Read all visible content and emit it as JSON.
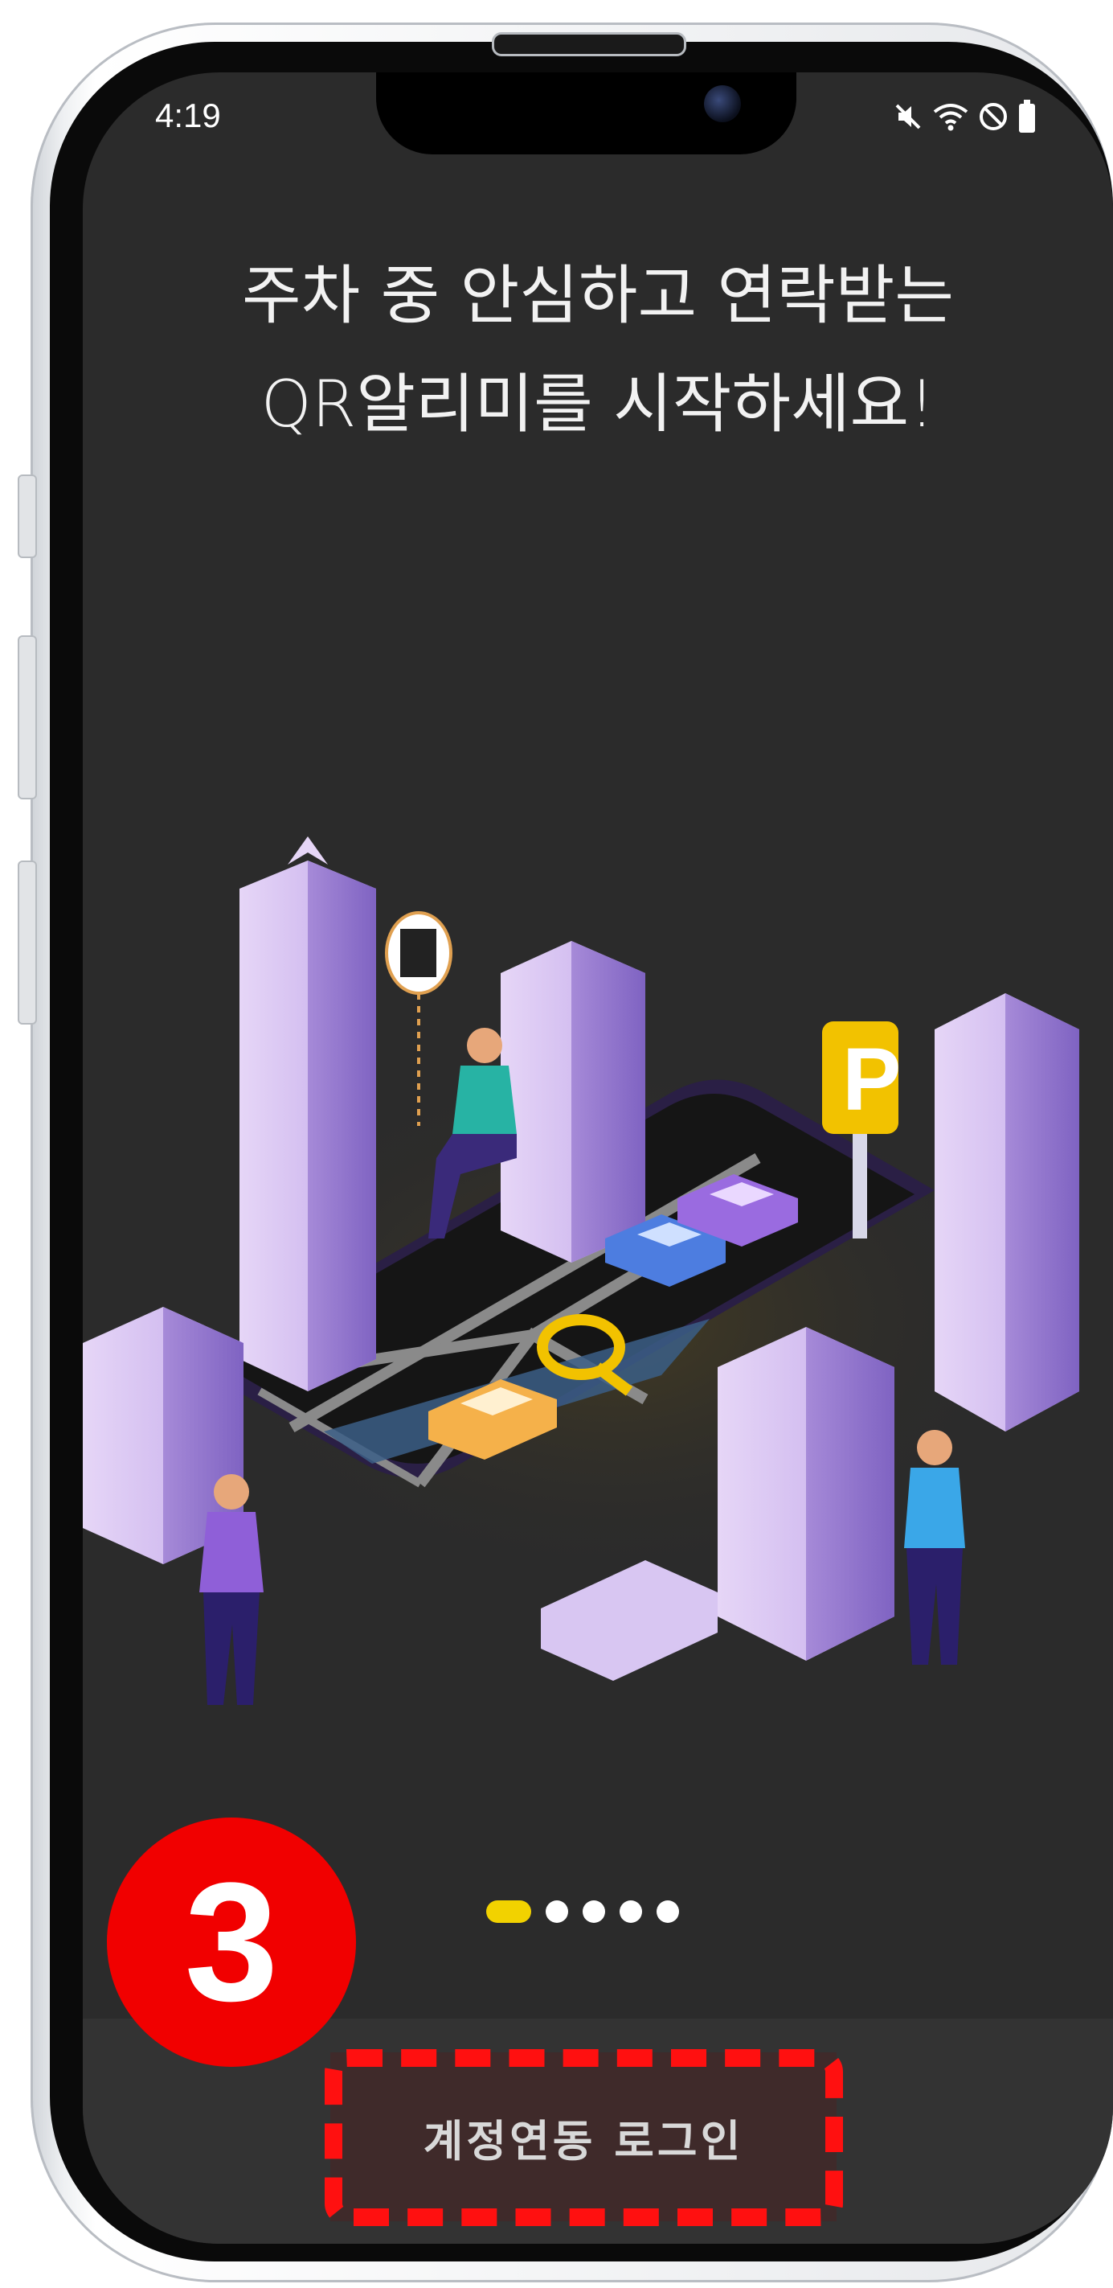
{
  "status_bar": {
    "time": "4:19",
    "icons": [
      "mute-icon",
      "wifi-icon",
      "do-not-disturb-icon",
      "battery-icon"
    ]
  },
  "onboarding": {
    "headline_line1": "주차 중 안심하고 연락받는",
    "headline_line2": "QR알리미를 시작하세요!",
    "page_indicator": {
      "total": 5,
      "current": 1
    }
  },
  "login_button": {
    "label": "계정연동 로그인"
  },
  "annotation": {
    "step_number": "3",
    "badge_color": "#f10000",
    "highlight_color": "#ff1010"
  },
  "colors": {
    "screen_bg": "#2b2b2b",
    "accent_yellow": "#f2d200",
    "bottom_panel": "#333333"
  }
}
